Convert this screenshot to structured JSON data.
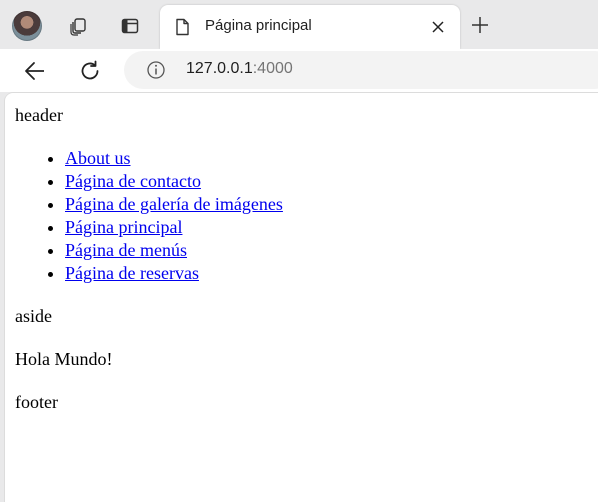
{
  "browser": {
    "tab": {
      "title": "Página principal"
    },
    "address": {
      "host": "127.0.0.1",
      "port": ":4000"
    },
    "icons": {
      "profile": "profile-avatar",
      "collections": "collections-icon",
      "tab_actions": "tab-actions-icon",
      "favicon": "document-icon",
      "close": "close-icon",
      "new_tab": "plus-icon",
      "back": "back-arrow-icon",
      "refresh": "refresh-icon",
      "site_info": "info-icon"
    }
  },
  "page": {
    "header": "header",
    "nav": {
      "links": [
        "About us",
        "Página de contacto",
        "Página de galería de imágenes",
        "Página principal",
        "Página de menús",
        "Página de reservas"
      ]
    },
    "aside": "aside",
    "main": "Hola Mundo!",
    "footer": "footer"
  },
  "colors": {
    "link": "#0000ee",
    "chrome_bg": "#e9e9ea",
    "address_bg": "#f3f3f3"
  }
}
